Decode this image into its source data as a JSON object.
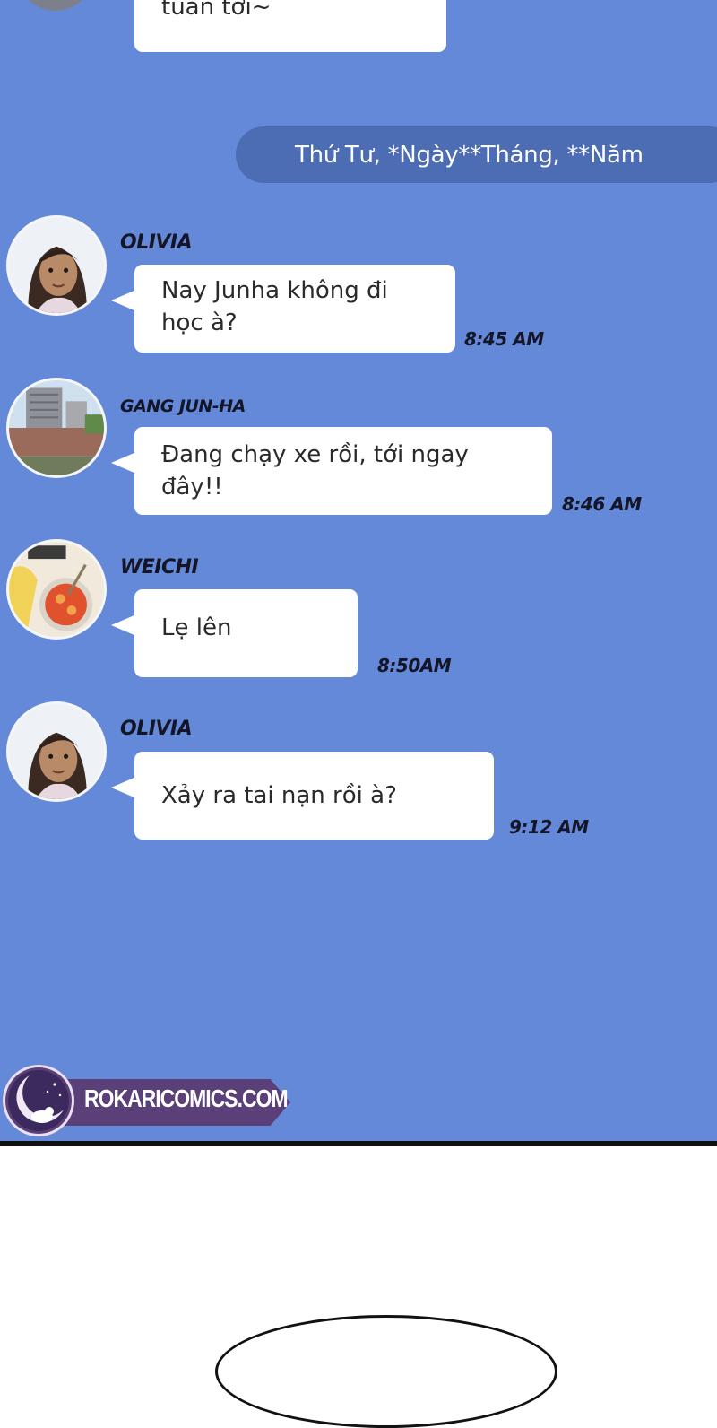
{
  "top_message": {
    "text": "tuần tới~"
  },
  "date_separator": "Thứ Tư, *Ngày**Tháng, **Năm",
  "messages": [
    {
      "sender": "OLIVIA",
      "avatar": "olivia-avatar",
      "text_line1": "Nay Junha không đi",
      "text_line2": "học à?",
      "time": "8:45 AM"
    },
    {
      "sender": "GANG JUN-HA",
      "avatar": "city-building-avatar",
      "text": "Đang chạy xe rồi, tới ngay đây!!",
      "time": "8:46 AM"
    },
    {
      "sender": "WEICHI",
      "avatar": "food-dish-avatar",
      "text": "Lẹ lên",
      "time": "8:50AM"
    },
    {
      "sender": "OLIVIA",
      "avatar": "olivia-avatar",
      "text": "Xảy ra tai nạn rồi à?",
      "time": "9:12 AM"
    }
  ],
  "watermark": {
    "text": "ROKARICOMICS.COM",
    "logo": "moon-cat-logo"
  },
  "colors": {
    "chat_background": "#6589d9",
    "date_pill": "#4c6cb4",
    "bubble": "#ffffff",
    "watermark_banner": "#5a3f78"
  }
}
